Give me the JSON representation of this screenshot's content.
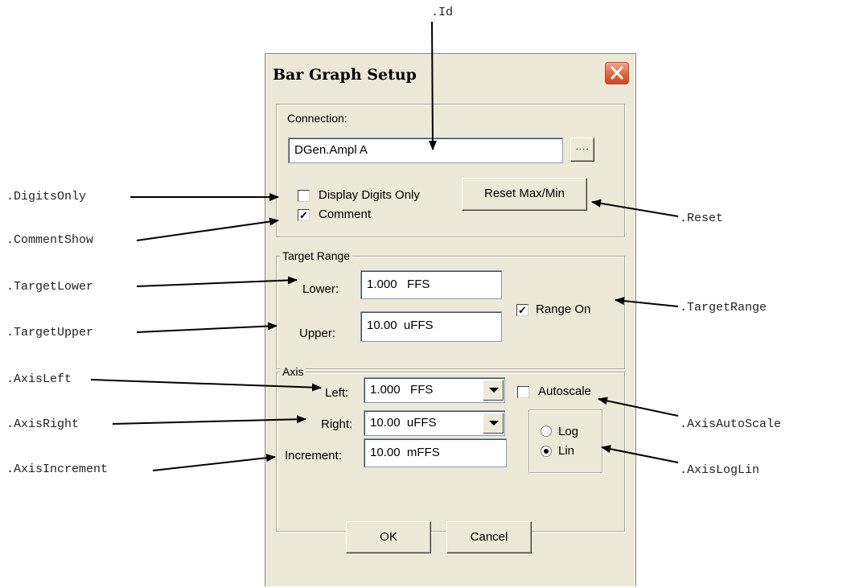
{
  "callouts": {
    "id": ".Id",
    "digits_only": ".DigitsOnly",
    "comment_show": ".CommentShow",
    "target_lower": ".TargetLower",
    "target_upper": ".TargetUpper",
    "axis_left": ".AxisLeft",
    "axis_right": ".AxisRight",
    "axis_increment": ".AxisIncrement",
    "reset": ".Reset",
    "target_range": ".TargetRange",
    "axis_auto_scale": ".AxisAutoScale",
    "axis_log_lin": ".AxisLogLin"
  },
  "dialog": {
    "title": "Bar Graph Setup",
    "close_icon": "close-x",
    "connection": {
      "label": "Connection:",
      "value": "DGen.Ampl A",
      "browse_label": "....",
      "display_digits_only": {
        "label": "Display Digits Only",
        "checked": false
      },
      "comment": {
        "label": "Comment",
        "checked": true
      },
      "reset_label": "Reset Max/Min"
    },
    "target_range": {
      "legend": "Target Range",
      "lower_label": "Lower:",
      "lower_value": "1.000   FFS",
      "upper_label": "Upper:",
      "upper_value": "10.00  uFFS",
      "range_on": {
        "label": "Range On",
        "checked": true
      }
    },
    "axis": {
      "legend": "Axis",
      "left_label": "Left:",
      "left_value": "1.000   FFS",
      "right_label": "Right:",
      "right_value": "10.00  uFFS",
      "increment_label": "Increment:",
      "increment_value": "10.00  mFFS",
      "autoscale": {
        "label": "Autoscale",
        "checked": false
      },
      "log_label": "Log",
      "lin_label": "Lin",
      "selected_scale": "Lin"
    },
    "ok_label": "OK",
    "cancel_label": "Cancel"
  },
  "colors": {
    "dialog_bg": "#ece9d8",
    "field_border": "#7f9db9",
    "close_button": "#e0653f"
  }
}
